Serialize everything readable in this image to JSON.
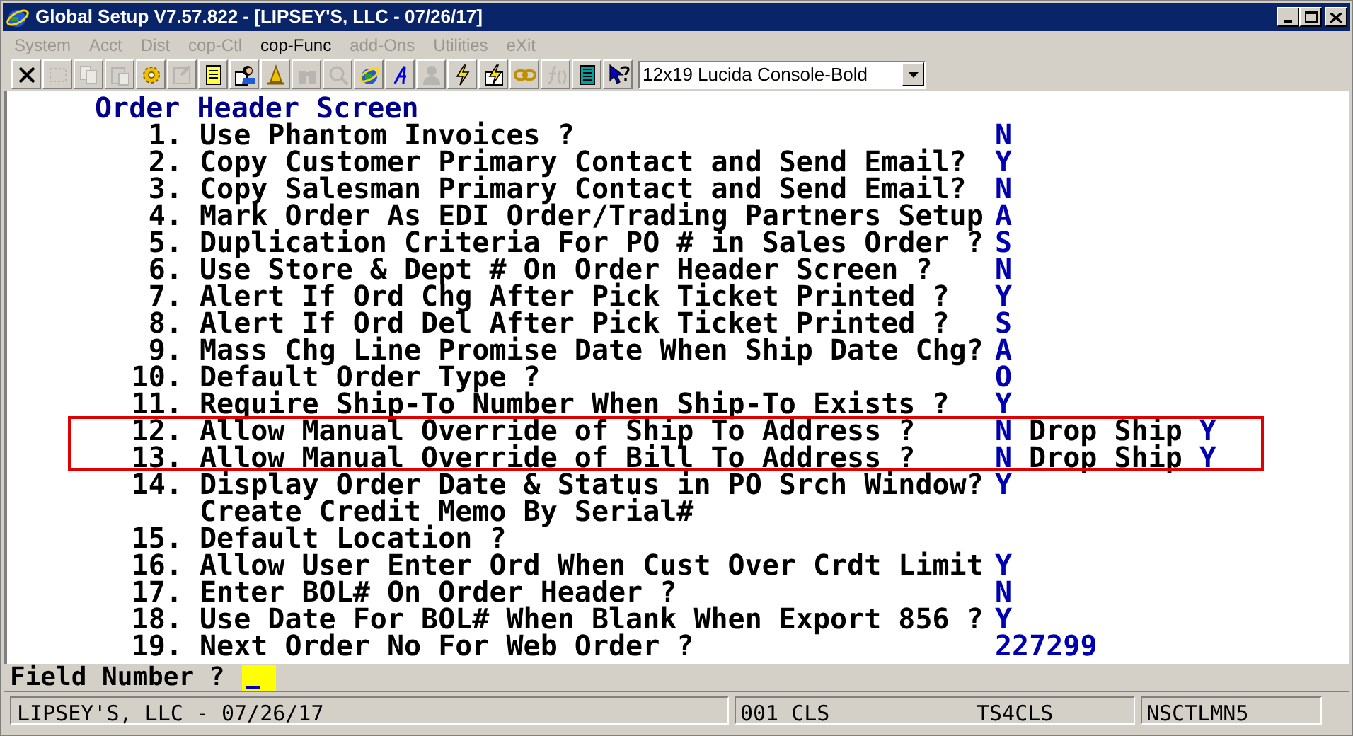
{
  "window": {
    "title": "Global Setup V7.57.822 - [LIPSEY'S, LLC - 07/26/17]"
  },
  "menu": [
    {
      "label": "System",
      "disabled": true
    },
    {
      "label": "Acct",
      "disabled": true
    },
    {
      "label": "Dist",
      "disabled": true
    },
    {
      "label": "cop-Ctl",
      "disabled": true
    },
    {
      "label": "cop-Func",
      "disabled": false
    },
    {
      "label": "add-Ons",
      "disabled": true
    },
    {
      "label": "Utilities",
      "disabled": true
    },
    {
      "label": "eXit",
      "disabled": true
    }
  ],
  "toolbar": [
    {
      "kind": "close",
      "disabled": false
    },
    {
      "kind": "select",
      "disabled": true
    },
    {
      "kind": "copy",
      "disabled": true
    },
    {
      "kind": "paste",
      "disabled": true
    },
    {
      "kind": "gear",
      "disabled": false
    },
    {
      "kind": "properties",
      "disabled": true
    },
    {
      "kind": "notepad",
      "disabled": false
    },
    {
      "kind": "user-doc",
      "disabled": false
    },
    {
      "kind": "bell",
      "disabled": false
    },
    {
      "kind": "binoculars",
      "disabled": true
    },
    {
      "kind": "magnifier",
      "disabled": true
    },
    {
      "kind": "globe",
      "disabled": false
    },
    {
      "kind": "script",
      "disabled": false
    },
    {
      "kind": "person",
      "disabled": true
    },
    {
      "kind": "bolt",
      "disabled": false
    },
    {
      "kind": "bolt-doc",
      "disabled": false
    },
    {
      "kind": "link",
      "disabled": false
    },
    {
      "kind": "function",
      "disabled": true
    },
    {
      "kind": "calculator",
      "disabled": false
    },
    {
      "kind": "help",
      "disabled": false
    }
  ],
  "font_select": {
    "value": "12x19 Lucida Console-Bold"
  },
  "screen": {
    "title": "Order Header Screen",
    "rows": [
      {
        "number": "1.",
        "label": "Use Phantom Invoices ?",
        "value": "N",
        "highlighted": false
      },
      {
        "number": "2.",
        "label": "Copy Customer Primary Contact and Send Email?",
        "value": "Y",
        "highlighted": false
      },
      {
        "number": "3.",
        "label": "Copy Salesman Primary Contact and Send Email?",
        "value": "N",
        "highlighted": false
      },
      {
        "number": "4.",
        "label": "Mark Order As EDI Order/Trading Partners Setup",
        "value": "A",
        "highlighted": false
      },
      {
        "number": "5.",
        "label": "Duplication Criteria For PO # in Sales Order ?",
        "value": "S",
        "highlighted": false
      },
      {
        "number": "6.",
        "label": "Use Store & Dept # On Order Header Screen ?",
        "value": "N",
        "highlighted": false
      },
      {
        "number": "7.",
        "label": "Alert If Ord Chg After Pick Ticket Printed ?",
        "value": "Y",
        "highlighted": false
      },
      {
        "number": "8.",
        "label": "Alert If Ord Del After Pick Ticket Printed ?",
        "value": "S",
        "highlighted": false
      },
      {
        "number": "9.",
        "label": "Mass Chg Line Promise Date When Ship Date Chg?",
        "value": "A",
        "highlighted": false
      },
      {
        "number": "10.",
        "label": "Default Order Type ?",
        "value": "O",
        "highlighted": false
      },
      {
        "number": "11.",
        "label": "Require Ship-To Number When Ship-To Exists ?",
        "value": "Y",
        "highlighted": false
      },
      {
        "number": "12.",
        "label": "Allow Manual Override of Ship To Address ?",
        "value": "N",
        "extra_label": "Drop Ship",
        "extra_value": "Y",
        "highlighted": true
      },
      {
        "number": "13.",
        "label": "Allow Manual Override of Bill To Address ?",
        "value": "N",
        "extra_label": "Drop Ship",
        "extra_value": "Y",
        "highlighted": true
      },
      {
        "number": "14.",
        "label": "Display Order Date & Status in PO Srch Window?",
        "value": "Y",
        "highlighted": false
      },
      {
        "label": "Create Credit Memo By Serial#",
        "highlighted": false
      },
      {
        "number": "15.",
        "label": "Default Location ?",
        "highlighted": false
      },
      {
        "number": "16.",
        "label": "Allow User Enter Ord When Cust Over Crdt Limit",
        "value": "Y",
        "highlighted": false
      },
      {
        "number": "17.",
        "label": "Enter BOL# On Order Header ?",
        "value": "N",
        "highlighted": false
      },
      {
        "number": "18.",
        "label": "Use Date For BOL# When Blank When Export 856 ?",
        "value": "Y",
        "highlighted": false
      },
      {
        "number": "19.",
        "label": "Next Order No For Web Order ?",
        "value": "227299",
        "highlighted": false
      }
    ]
  },
  "prompt": {
    "label": "Field Number ?"
  },
  "status_bar": {
    "company": "LIPSEY'S, LLC - 07/26/17",
    "code": "001 CLS",
    "station": "TS4CLS",
    "user": "NSCTLMN5"
  }
}
